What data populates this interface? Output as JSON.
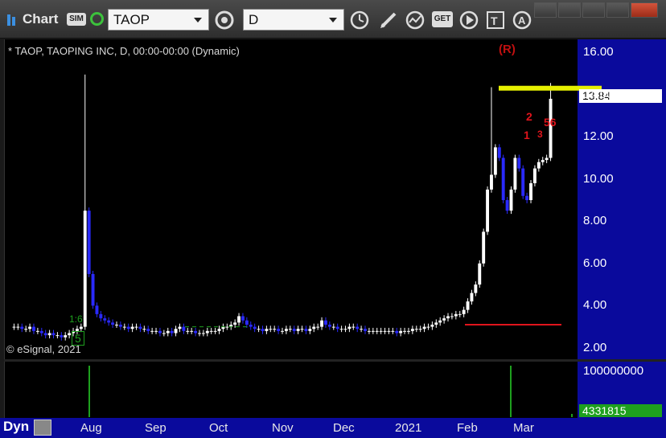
{
  "toolbar": {
    "app_title": "Chart",
    "sim_badge": "SIM",
    "symbol": "TAOP",
    "interval": "D",
    "icons": [
      "link-icon",
      "settings-icon",
      "clock-icon",
      "pencil-icon",
      "study-icon",
      "get-icon",
      "play-icon",
      "text-icon",
      "alert-icon"
    ],
    "get_label": "GET"
  },
  "window": {
    "buttons": [
      "link-window",
      "minimize",
      "maximize",
      "close"
    ]
  },
  "chart": {
    "label": "* TAOP, TAOPING INC, D, 00:00-00:00 (Dynamic)",
    "copyright": "© eSignal, 2021",
    "price_last": "13.84",
    "volume_last": "4331815",
    "volume_tick": "100000000",
    "r_marker": "(R)",
    "dyn_label": "Dyn",
    "annotations": {
      "red_2": "2",
      "red_1": "1",
      "red_56": "56",
      "red_colon": "3",
      "green_16": "1:6",
      "green_5": "5"
    },
    "colors": {
      "background": "#000000",
      "axis": "#0a0a9c",
      "up_candle": "#ffffff",
      "down_candle": "#2a2aff",
      "resistance_line": "#e6f000",
      "support_line": "#e0141c",
      "volume": "#1ea01e"
    }
  },
  "chart_data": {
    "type": "candlestick",
    "ylim": [
      1.5,
      16.5
    ],
    "y_ticks": [
      "16.00",
      "14.00",
      "12.00",
      "10.00",
      "8.00",
      "6.00",
      "4.00",
      "2.00"
    ],
    "x_labels": [
      "Aug",
      "Sep",
      "Oct",
      "Nov",
      "Dec",
      "2021",
      "Feb",
      "Mar"
    ],
    "resistance": 14.3,
    "support": 3.1,
    "close_series": [
      3.0,
      3.0,
      2.9,
      2.9,
      3.0,
      2.8,
      2.8,
      2.7,
      2.6,
      2.7,
      2.6,
      2.6,
      2.5,
      2.6,
      2.7,
      2.8,
      2.9,
      3.0,
      8.5,
      5.5,
      4.0,
      3.6,
      3.4,
      3.3,
      3.2,
      3.1,
      3.1,
      3.0,
      3.0,
      2.9,
      3.0,
      3.0,
      2.9,
      2.9,
      2.8,
      2.8,
      2.8,
      2.7,
      2.7,
      2.8,
      2.7,
      2.9,
      3.0,
      2.8,
      2.8,
      2.8,
      2.7,
      2.7,
      2.7,
      2.8,
      2.8,
      2.8,
      2.9,
      3.0,
      3.0,
      3.1,
      3.2,
      3.5,
      3.3,
      3.1,
      3.0,
      2.9,
      2.9,
      2.8,
      2.9,
      2.9,
      2.9,
      2.8,
      2.8,
      2.9,
      2.9,
      2.8,
      2.9,
      2.9,
      2.8,
      2.9,
      3.0,
      3.0,
      3.3,
      3.1,
      3.0,
      3.0,
      2.9,
      2.9,
      2.9,
      3.0,
      3.0,
      2.9,
      2.9,
      2.8,
      2.8,
      2.8,
      2.8,
      2.8,
      2.8,
      2.8,
      2.8,
      2.7,
      2.8,
      2.8,
      2.8,
      2.9,
      2.9,
      2.9,
      3.0,
      3.0,
      3.1,
      3.2,
      3.3,
      3.4,
      3.5,
      3.5,
      3.6,
      3.6,
      3.8,
      4.2,
      4.6,
      5.0,
      6.0,
      7.5,
      9.5,
      10.2,
      11.5,
      11.0,
      9.0,
      8.5,
      9.5,
      11.0,
      10.5,
      9.2,
      9.0,
      9.8,
      10.5,
      10.8,
      10.9,
      11.0,
      13.8
    ],
    "volume_spikes": [
      {
        "x": "Aug",
        "value": 100000000
      },
      {
        "x": "Feb",
        "value": 100000000
      },
      {
        "x": "Mar",
        "value": 4331815
      }
    ]
  }
}
